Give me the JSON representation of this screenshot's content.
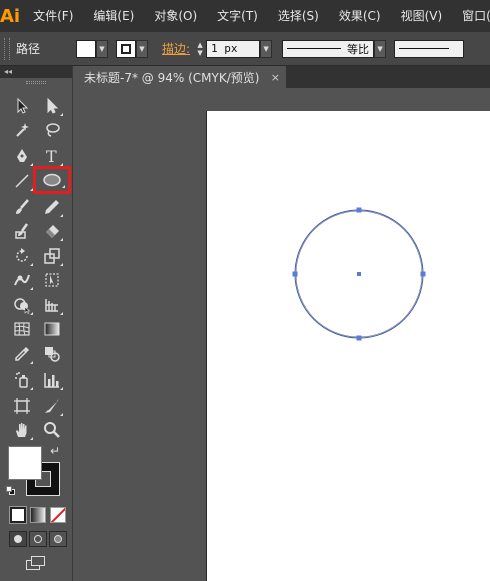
{
  "app": {
    "logo_text": "Ai",
    "brand_color": "#ff9a00"
  },
  "menu": [
    {
      "label": "文件(F)"
    },
    {
      "label": "编辑(E)"
    },
    {
      "label": "对象(O)"
    },
    {
      "label": "文字(T)"
    },
    {
      "label": "选择(S)"
    },
    {
      "label": "效果(C)"
    },
    {
      "label": "视图(V)"
    },
    {
      "label": "窗口("
    }
  ],
  "control": {
    "selection_label": "路径",
    "stroke_label": "描边:",
    "stroke_weight": "1 px",
    "profile_label": "等比",
    "fill_color": "#ffffff",
    "stroke_color": "#000000"
  },
  "panel": {
    "collapse_glyph": "◂◂"
  },
  "document": {
    "tab_title": "未标题-7* @ 94% (CMYK/预览)",
    "close_glyph": "×"
  },
  "tools": [
    "selection-tool",
    "direct-selection-tool",
    "magic-wand-tool",
    "lasso-tool",
    "pen-tool",
    "type-tool",
    "line-segment-tool",
    "ellipse-tool",
    "paintbrush-tool",
    "pencil-tool",
    "blob-brush-tool",
    "eraser-tool",
    "rotate-tool",
    "scale-tool",
    "warp-tool",
    "free-transform-tool",
    "shape-builder-tool",
    "perspective-grid-tool",
    "mesh-tool",
    "gradient-tool",
    "eyedropper-tool",
    "blend-tool",
    "symbol-sprayer-tool",
    "column-graph-tool",
    "artboard-tool",
    "slice-tool",
    "hand-tool",
    "zoom-tool"
  ],
  "selected_tool": "ellipse-tool",
  "highlight_color": "#e0201e",
  "path_color": "#3b5bb5"
}
